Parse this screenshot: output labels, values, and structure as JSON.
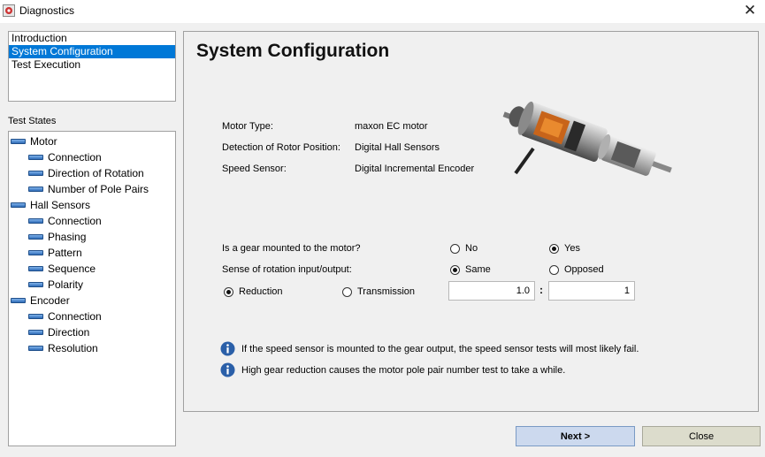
{
  "window": {
    "title": "Diagnostics"
  },
  "nav": {
    "items": [
      {
        "label": "Introduction",
        "selected": false
      },
      {
        "label": "System Configuration",
        "selected": true
      },
      {
        "label": "Test Execution",
        "selected": false
      }
    ]
  },
  "test_states": {
    "label": "Test States",
    "groups": [
      {
        "label": "Motor",
        "children": [
          "Connection",
          "Direction of Rotation",
          "Number of Pole Pairs"
        ]
      },
      {
        "label": "Hall Sensors",
        "children": [
          "Connection",
          "Phasing",
          "Pattern",
          "Sequence",
          "Polarity"
        ]
      },
      {
        "label": "Encoder",
        "children": [
          "Connection",
          "Direction",
          "Resolution"
        ]
      }
    ]
  },
  "config": {
    "title": "System Configuration",
    "motor_type_label": "Motor Type:",
    "motor_type_value": "maxon EC motor",
    "rotor_label": "Detection of Rotor Position:",
    "rotor_value": "Digital Hall Sensors",
    "speed_label": "Speed Sensor:",
    "speed_value": "Digital Incremental Encoder",
    "gear_question": "Is a gear mounted to the motor?",
    "gear_no": "No",
    "gear_yes": "Yes",
    "gear_selected": "Yes",
    "rotation_question": "Sense of rotation input/output:",
    "rotation_same": "Same",
    "rotation_opposed": "Opposed",
    "rotation_selected": "Same",
    "ratio_reduction": "Reduction",
    "ratio_transmission": "Transmission",
    "ratio_selected": "Reduction",
    "ratio_input": "1.0",
    "ratio_separator": ":",
    "ratio_output": "1",
    "notes": [
      "If the speed sensor is mounted to the gear output, the speed sensor tests will most likely fail.",
      "High gear reduction causes the motor pole pair number test to take a while."
    ]
  },
  "buttons": {
    "next": "Next >",
    "close": "Close"
  },
  "colors": {
    "selection": "#0078d7",
    "state_indicator": "#2f6cb8",
    "next_button": "#ccd9ee",
    "close_button": "#dcdccc",
    "info_icon": "#2a5fa8"
  },
  "icons": {
    "app": "app-icon",
    "close": "close-x-icon",
    "info": "info-icon",
    "state": "state-bar-icon"
  }
}
